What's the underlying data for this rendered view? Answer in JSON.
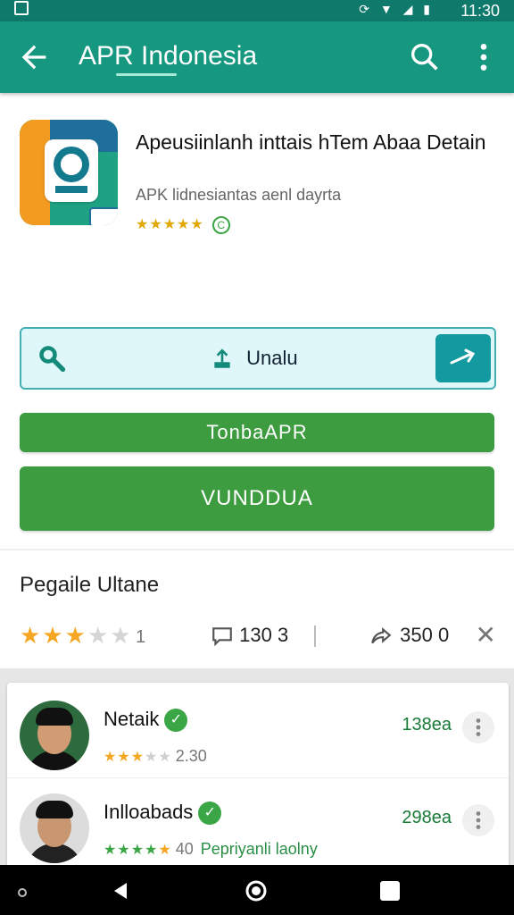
{
  "status_bar": {
    "time": "11:30",
    "icons": [
      "sim-card-icon",
      "sync-icon",
      "wifi-icon",
      "signal-icon",
      "battery-icon"
    ]
  },
  "app_bar": {
    "title": "APR Indonesia",
    "back_icon": "arrow-left-icon",
    "search_icon": "search-icon",
    "more_icon": "more-vert-icon",
    "bg_color": "#16977f"
  },
  "app_header": {
    "title": "Apeusiinlanh inttais hTem Abaa Detain",
    "subtitle": "APK lidnesiantas aenl dayrta",
    "rating_stars": "★★★★★",
    "rating_badge": "C"
  },
  "search_box": {
    "label": "Unalu",
    "left_icon": "key-icon",
    "center_icon": "upload-icon",
    "action_icon": "arrow-right-icon"
  },
  "buttons": {
    "primary_small": "TonbaAPR",
    "primary_large": "VUNDDUA",
    "color": "#3d9c3f"
  },
  "section": {
    "title": "Pegaile Ultane"
  },
  "stats": {
    "rating_value": 2.5,
    "rating_count": "1",
    "comments": "130 3",
    "shares": "350 0",
    "comment_icon": "comment-icon",
    "share_icon": "share-icon",
    "close_icon": "close-icon"
  },
  "reviewers": [
    {
      "name": "Netaik",
      "verified_icon": "verified-check-icon",
      "rating_value": 3,
      "rating_text": "2.30",
      "amount": "138ea",
      "more_icon": "kebab-icon"
    },
    {
      "name": "Inlloabads",
      "verified_icon": "verified-check-icon",
      "rating_value": 4.5,
      "rating_text": "40",
      "extra": "Pepriyanli laolny",
      "amount": "298ea",
      "more_icon": "kebab-icon"
    }
  ],
  "nav_bar": {
    "back_icon": "nav-back-icon",
    "home_icon": "nav-home-icon",
    "recents_icon": "nav-recents-icon"
  }
}
